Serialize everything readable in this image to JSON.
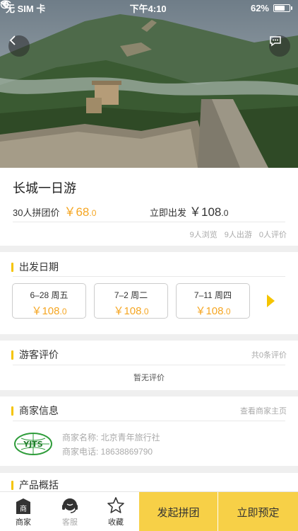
{
  "status_bar": {
    "carrier": "无 SIM 卡",
    "time": "下午4:10",
    "battery": "62%"
  },
  "product": {
    "title": "长城一日游",
    "group_label": "30人拼团价",
    "group_price_int": "￥68",
    "group_price_dec": ".0",
    "now_label": "立即出发",
    "now_price_int": "￥108",
    "now_price_dec": ".0",
    "stats": {
      "views": "9人浏览",
      "departed": "9人出游",
      "reviews": "0人评价"
    }
  },
  "departure": {
    "title": "出发日期",
    "dates": [
      {
        "date": "6–28 周五",
        "price_int": "￥108",
        "price_dec": ".0"
      },
      {
        "date": "7–2 周二",
        "price_int": "￥108",
        "price_dec": ".0"
      },
      {
        "date": "7–11 周四",
        "price_int": "￥108",
        "price_dec": ".0"
      }
    ]
  },
  "reviews": {
    "title": "游客评价",
    "count_text": "共0条评价",
    "empty_text": "暂无评价"
  },
  "merchant": {
    "title": "商家信息",
    "link": "查看商家主页",
    "logo_text": "YJTS",
    "name_line": "商家名称: 北京青年旅行社",
    "phone_line": "商家电话: 18638869790"
  },
  "product_overview": {
    "title": "产品概括"
  },
  "bottom_bar": {
    "merchant_label": "商家",
    "merchant_icon_char": "商",
    "service_label": "客服",
    "favorite_label": "收藏",
    "group_button": "发起拼团",
    "book_button": "立即预定"
  },
  "colors": {
    "accent": "#f5c400",
    "price": "#f5a623",
    "cta": "#f7d047"
  }
}
